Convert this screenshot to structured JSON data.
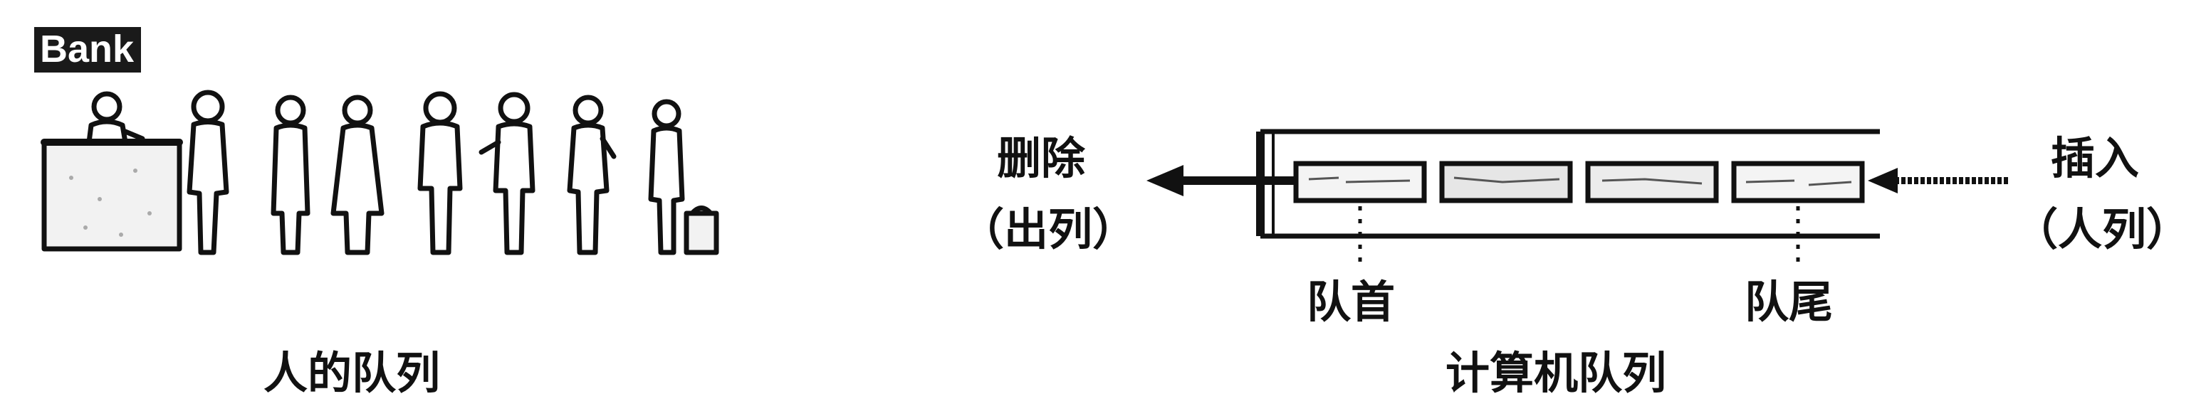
{
  "colors": {
    "ink": "#111111",
    "background": "#ffffff"
  },
  "left_panel": {
    "bank_label": "Bank",
    "caption": "人的队列",
    "icons": {
      "counter": "bank-counter-icon",
      "people": "queue-person-icon"
    }
  },
  "right_panel": {
    "caption": "计算机队列",
    "delete": {
      "line1": "删除",
      "line2": "（出列）"
    },
    "insert": {
      "line1": "插入",
      "line2": "（人列）"
    },
    "head_label": "队首",
    "tail_label": "队尾",
    "cell_count": 4
  }
}
